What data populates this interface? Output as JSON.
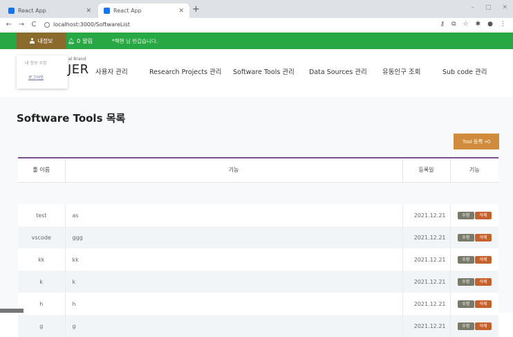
{
  "browser": {
    "tabs": [
      {
        "title": "React App",
        "active": false
      },
      {
        "title": "React App",
        "active": true
      }
    ],
    "new_tab": "+",
    "url": "localhost:3000/SoftwareList",
    "nav": {
      "back": "←",
      "forward": "→",
      "reload": "C"
    },
    "window_controls": [
      "–",
      "□",
      "✕"
    ],
    "toolbar_icons": [
      "key-icon",
      "translate-icon",
      "star-icon",
      "extension-icon",
      "profile-icon",
      "menu-icon"
    ]
  },
  "topbar": {
    "user_label": "내정보",
    "alarm_count": "0",
    "alarm_label": "알림",
    "welcome": "*핵핸 님 반갑습니다."
  },
  "brand": {
    "edit_label": "내 정보 수정",
    "logout_label": "로그아웃",
    "small_text": "al Brand",
    "big_text": "JER"
  },
  "nav": {
    "items": [
      "사용자 관리",
      "Research Projects 관리",
      "Software Tools 관리",
      "Data Sources 관리",
      "유동인구 조회",
      "Sub code 관리"
    ]
  },
  "page": {
    "title": "Software Tools 목록",
    "add_button": "Tool 등록 +0"
  },
  "table": {
    "headers": [
      "툴 이름",
      "기능",
      "등록일",
      "기능"
    ],
    "rows": [
      {
        "name": "test",
        "func": "as",
        "date": "2021.12.21"
      },
      {
        "name": "vscode",
        "func": "ggg",
        "date": "2021.12.21"
      },
      {
        "name": "kk",
        "func": "kk",
        "date": "2021.12.21"
      },
      {
        "name": "k",
        "func": "k",
        "date": "2021.12.21"
      },
      {
        "name": "h",
        "func": "h",
        "date": "2021.12.21"
      },
      {
        "name": "g",
        "func": "g",
        "date": "2021.12.21"
      }
    ],
    "edit_label": "수정",
    "delete_label": "삭제"
  },
  "colors": {
    "topbar_green": "#28a745",
    "user_brown": "#8b6a2e",
    "add_button_orange": "#d08c3c",
    "table_top_border": "#7b4e91",
    "edit_button": "#7a7a6a",
    "delete_button": "#c4622d"
  }
}
